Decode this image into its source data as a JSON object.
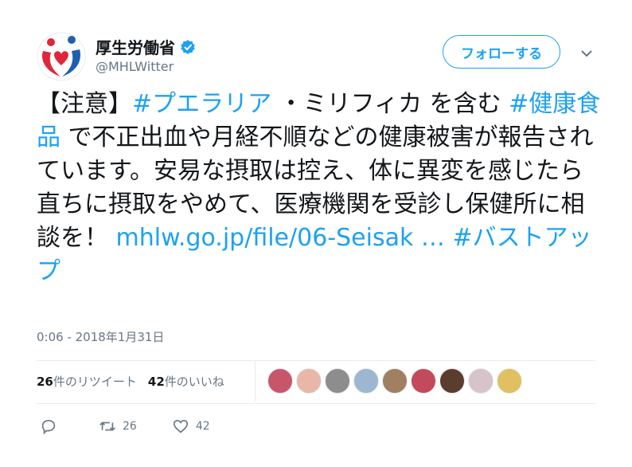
{
  "account": {
    "display_name": "厚生労働省",
    "handle": "@MHLWitter",
    "verified_icon": "verified-badge-icon",
    "follow_label": "フォローする"
  },
  "tweet": {
    "part1": "【注意】",
    "tag1": "#プエラリア",
    "part2": " ・ミリフィカ を含む ",
    "tag2": "#健康食品",
    "part3": " で不正出血や月経不順などの健康被害が報告されています。安易な摂取は控え、体に異変を感じたら直ちに摂取をやめて、医療機関を受診し保健所に相談を！ ",
    "link": "mhlw.go.jp/file/06-Seisak …",
    "part4": " ",
    "tag3": "#バストアップ"
  },
  "timestamp": "0:06 - 2018年1月31日",
  "stats": {
    "retweets_count": "26",
    "retweets_label": "件のリツイート",
    "likes_count": "42",
    "likes_label": "件のいいね"
  },
  "liker_colors": [
    "#c8566b",
    "#e9b7a8",
    "#8d8d8d",
    "#9db7d1",
    "#a08060",
    "#c24a5a",
    "#5a3d2e",
    "#d6c4c8",
    "#e0c060"
  ],
  "actions": {
    "reply_count": "",
    "retweet_count": "26",
    "like_count": "42"
  },
  "colors": {
    "accent": "#1da1f2",
    "muted": "#657786",
    "logo_red": "#e0263a",
    "logo_blue": "#1f5fb0"
  }
}
